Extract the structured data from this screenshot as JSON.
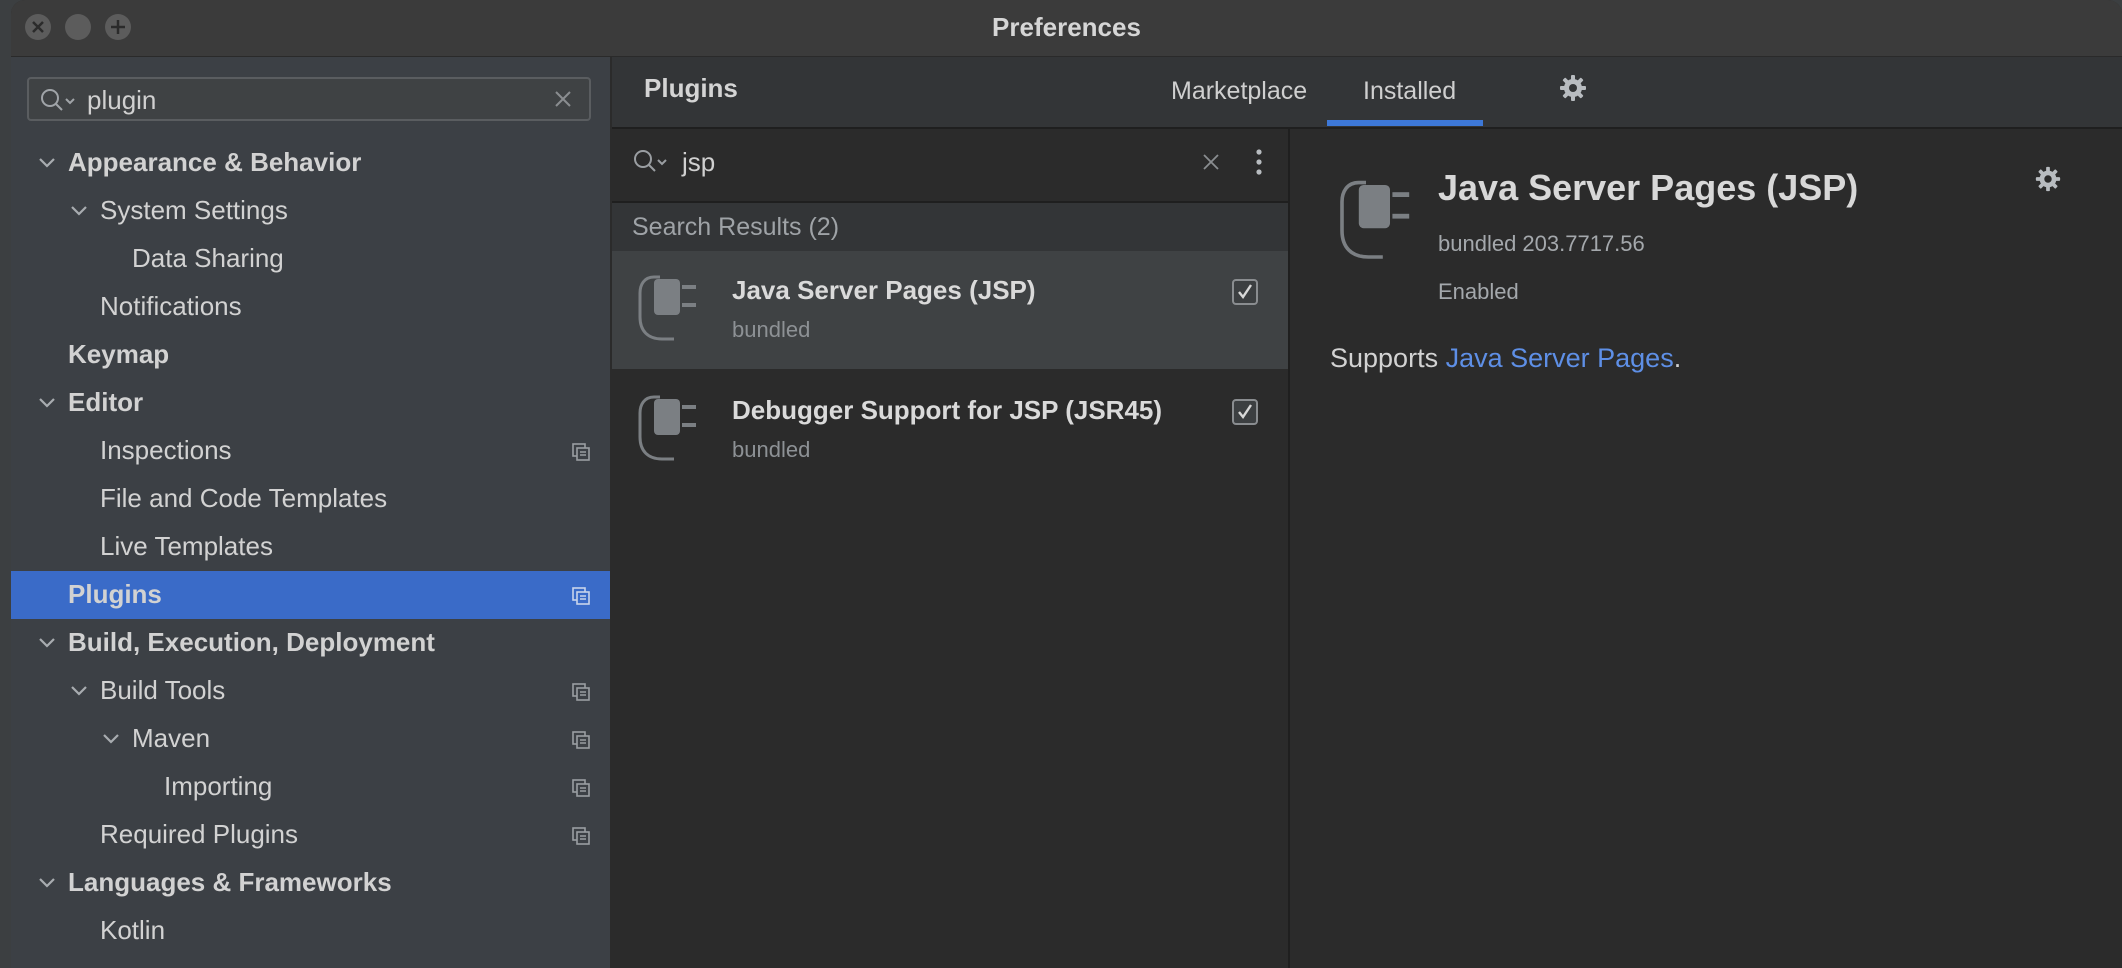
{
  "window": {
    "title": "Preferences"
  },
  "sidebar": {
    "search_value": "plugin",
    "items": [
      {
        "label": "Appearance & Behavior",
        "expanded": true,
        "level": 0,
        "bold": true
      },
      {
        "label": "System Settings",
        "expanded": true,
        "level": 1,
        "bold": false
      },
      {
        "label": "Data Sharing",
        "level": 2,
        "bold": false
      },
      {
        "label": "Notifications",
        "level": 1,
        "bold": false
      },
      {
        "label": "Keymap",
        "level": 0,
        "bold": true
      },
      {
        "label": "Editor",
        "expanded": true,
        "level": 0,
        "bold": true
      },
      {
        "label": "Inspections",
        "level": 1,
        "bold": false,
        "copy_icon": true
      },
      {
        "label": "File and Code Templates",
        "level": 1,
        "bold": false
      },
      {
        "label": "Live Templates",
        "level": 1,
        "bold": false
      },
      {
        "label": "Plugins",
        "level": 0,
        "bold": true,
        "selected": true,
        "copy_icon": true
      },
      {
        "label": "Build, Execution, Deployment",
        "expanded": true,
        "level": 0,
        "bold": true
      },
      {
        "label": "Build Tools",
        "expanded": true,
        "level": 1,
        "bold": false,
        "copy_icon": true
      },
      {
        "label": "Maven",
        "expanded": true,
        "level": 2,
        "bold": false,
        "copy_icon": true
      },
      {
        "label": "Importing",
        "level": 3,
        "bold": false,
        "copy_icon": true
      },
      {
        "label": "Required Plugins",
        "level": 1,
        "bold": false,
        "copy_icon": true
      },
      {
        "label": "Languages & Frameworks",
        "expanded": true,
        "level": 0,
        "bold": true
      },
      {
        "label": "Kotlin",
        "level": 1,
        "bold": false
      }
    ]
  },
  "header": {
    "title": "Plugins",
    "tabs": [
      {
        "label": "Marketplace",
        "active": false
      },
      {
        "label": "Installed",
        "active": true
      }
    ],
    "settings_icon": "gear-icon"
  },
  "plugin_list": {
    "search_value": "jsp",
    "results_label": "Search Results (2)",
    "items": [
      {
        "name": "Java Server Pages (JSP)",
        "sub": "bundled",
        "checked": true,
        "selected": true
      },
      {
        "name": "Debugger Support for JSP (JSR45)",
        "sub": "bundled",
        "checked": true,
        "selected": false
      }
    ]
  },
  "detail": {
    "name": "Java Server Pages (JSP)",
    "version": "bundled 203.7717.56",
    "status": "Enabled",
    "desc_prefix": "Supports ",
    "desc_link": "Java Server Pages",
    "desc_suffix": "."
  },
  "colors": {
    "accent": "#3a6bc8",
    "tab_underline": "#3d78d8",
    "link": "#5e8fe6"
  }
}
